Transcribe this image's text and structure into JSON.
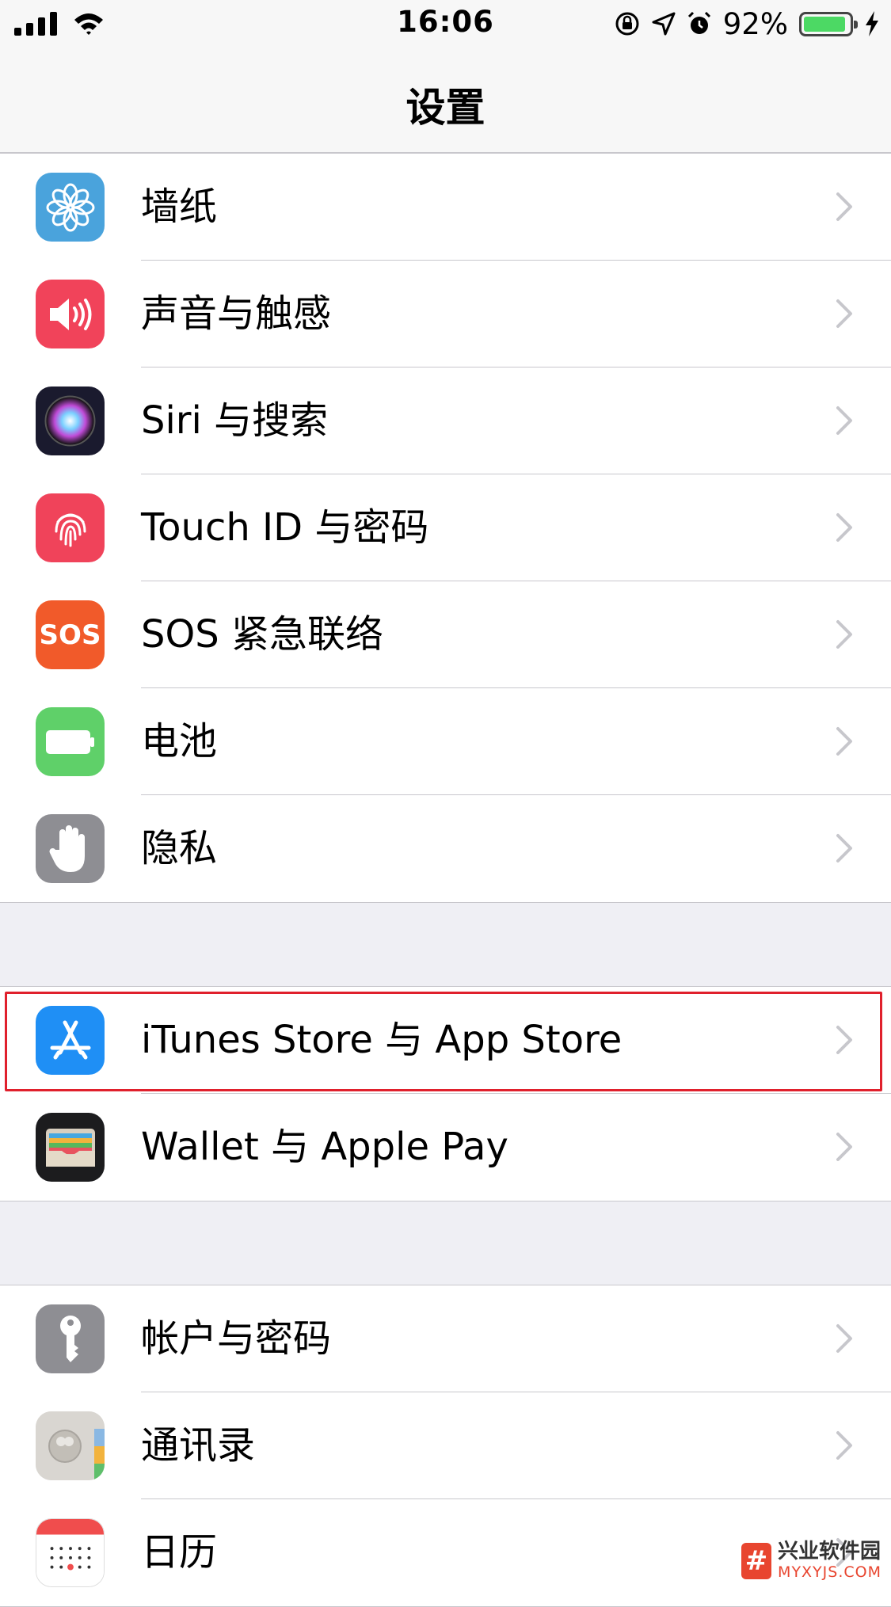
{
  "status_bar": {
    "time": "16:06",
    "battery_percent": "92%",
    "battery_level": 0.92,
    "icons": [
      "signal-icon",
      "wifi-icon",
      "rotation-lock-icon",
      "location-icon",
      "alarm-icon",
      "battery-icon",
      "charging-icon"
    ]
  },
  "nav": {
    "title": "设置"
  },
  "groups": [
    {
      "rows": [
        {
          "label": "墙纸",
          "icon": "wallpaper-icon",
          "color": "#4aa3dc"
        },
        {
          "label": "声音与触感",
          "icon": "sound-icon",
          "color": "#f1435a"
        },
        {
          "label": "Siri 与搜索",
          "icon": "siri-icon",
          "color": "#1a1a2e"
        },
        {
          "label": "Touch ID 与密码",
          "icon": "touch-id-icon",
          "color": "#f0435a"
        },
        {
          "label": "SOS 紧急联络",
          "icon": "sos-icon",
          "icon_text": "SOS",
          "color": "#f15a2a"
        },
        {
          "label": "电池",
          "icon": "battery-app-icon",
          "color": "#5fd069"
        },
        {
          "label": "隐私",
          "icon": "privacy-hand-icon",
          "color": "#8e8e93"
        }
      ]
    },
    {
      "rows": [
        {
          "label": "iTunes Store 与 App Store",
          "icon": "app-store-icon",
          "color": "#1f8ff5"
        },
        {
          "label": "Wallet 与 Apple Pay",
          "icon": "wallet-icon",
          "color": "#1c1c1e"
        }
      ]
    },
    {
      "rows": [
        {
          "label": "帐户与密码",
          "icon": "key-icon",
          "color": "#8e8e93"
        },
        {
          "label": "通讯录",
          "icon": "contacts-icon",
          "color": "#d9d6d1"
        },
        {
          "label": "日历",
          "icon": "calendar-icon",
          "color": "#ffffff"
        }
      ]
    }
  ],
  "watermark": {
    "badge": "#",
    "cn": "兴业软件园",
    "en": "MYXYJS.COM",
    "color": "#e8452f"
  }
}
